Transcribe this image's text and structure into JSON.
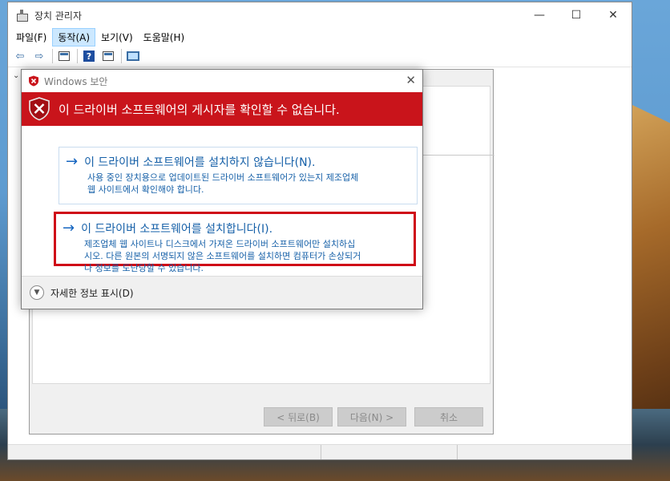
{
  "device_manager": {
    "title": "장치 관리자",
    "menu": [
      "파일(F)",
      "동작(A)",
      "보기(V)",
      "도움말(H)"
    ],
    "active_menu_index": 1
  },
  "wizard": {
    "back_label": "< 뒤로(B)",
    "next_label": "다음(N) >",
    "cancel_label": "취소"
  },
  "security_dialog": {
    "title": "Windows 보안",
    "banner_text": "이 드라이버 소프트웨어의 게시자를 확인할 수 없습니다.",
    "option_dont_install": {
      "title": "이 드라이버 소프트웨어를 설치하지 않습니다(N).",
      "desc_line1": "사용 중인 장치용으로 업데이트된 드라이버 소프트웨어가 있는지 제조업체",
      "desc_line2": "웹 사이트에서 확인해야 합니다."
    },
    "option_install": {
      "title": "이 드라이버 소프트웨어를 설치합니다(I).",
      "desc_line1": "제조업체 웹 사이트나 디스크에서 가져온 드라이버 소프트웨어만 설치하십",
      "desc_line2": "시오. 다른 원본의 서명되지 않은 소프트웨어를 설치하면 컴퓨터가 손상되거",
      "desc_line3": "나 정보를 도난당할 수 있습니다."
    },
    "details_label": "자세한 정보 표시(D)"
  },
  "colors": {
    "banner_red": "#c9141b",
    "highlight_red": "#cf0a17",
    "link_blue": "#1660a8"
  }
}
